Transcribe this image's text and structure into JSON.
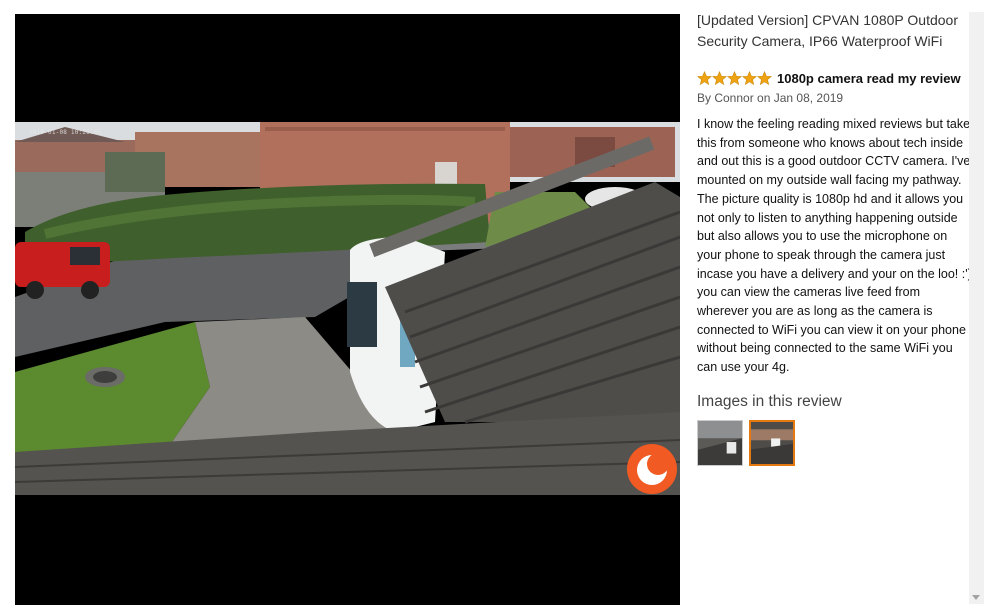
{
  "viewer": {
    "overlay_timestamp": "2019-01-08 10:26:05",
    "watermark_icon": "camera-brand-icon",
    "watermark_color": "#f15a22"
  },
  "product": {
    "title": "[Updated Version] CPVAN 1080P Outdoor Security Camera, IP66 Waterproof WiFi"
  },
  "review": {
    "rating": 5,
    "rating_max": 5,
    "star_color": "#f0a312",
    "title": "1080p camera read my review",
    "byline": "By Connor on Jan 08, 2019",
    "body": "I know the feeling reading mixed reviews but take this from someone who knows about tech inside and out this is a good outdoor CCTV camera. I've mounted on my outside wall facing my pathway. The picture quality is 1080p hd and it allows you not only to listen to anything happening outside but also allows you to use the microphone on your phone to speak through the camera just incase you have a delivery and your on the loo! :') you can view the cameras live feed from wherever you are as long as the camera is connected to WiFi you can view it on your phone without being connected to the same WiFi you can use your 4g."
  },
  "images_section": {
    "heading": "Images in this review",
    "thumbnails": [
      {
        "name": "thumbnail-1",
        "selected": false
      },
      {
        "name": "thumbnail-2",
        "selected": true
      }
    ],
    "selected_border_color": "#e47911"
  }
}
